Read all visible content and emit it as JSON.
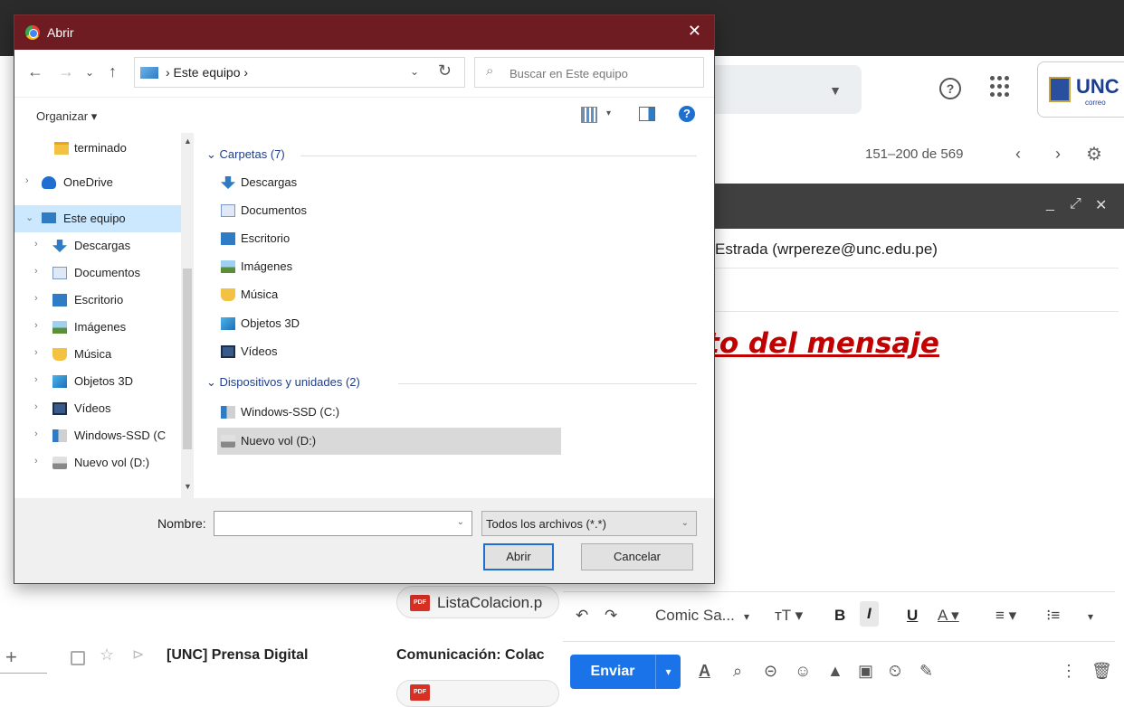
{
  "dialog": {
    "title": "Abrir",
    "close_glyph": "✕",
    "nav_back": "←",
    "nav_forward": "→",
    "nav_recent": "⌄",
    "nav_up": "↑",
    "breadcrumb": "› Este equipo ›",
    "breadcrumb_dropdown": "⌄",
    "refresh_glyph": "↻",
    "search_placeholder": "Buscar en Este equipo",
    "organize_label": "Organizar ▾",
    "view_dropdown": "▾",
    "help_glyph": "?",
    "nav_pane": [
      {
        "label": "terminado",
        "icon": "folder-icon",
        "arrow": ""
      },
      {
        "label": "OneDrive",
        "icon": "onedrive-icon",
        "arrow": "›"
      },
      {
        "label": "Este equipo",
        "icon": "computer-icon",
        "arrow": "⌄"
      },
      {
        "label": "Descargas",
        "icon": "downloads-icon",
        "arrow": "›"
      },
      {
        "label": "Documentos",
        "icon": "documents-icon",
        "arrow": "›"
      },
      {
        "label": "Escritorio",
        "icon": "desktop-icon",
        "arrow": "›"
      },
      {
        "label": "Imágenes",
        "icon": "pictures-icon",
        "arrow": "›"
      },
      {
        "label": "Música",
        "icon": "music-icon",
        "arrow": "›"
      },
      {
        "label": "Objetos 3D",
        "icon": "objects-3d-icon",
        "arrow": "›"
      },
      {
        "label": "Vídeos",
        "icon": "videos-icon",
        "arrow": "›"
      },
      {
        "label": "Windows-SSD (C",
        "icon": "drive-icon",
        "arrow": "›"
      },
      {
        "label": "Nuevo vol (D:)",
        "icon": "drive-icon",
        "arrow": "›"
      }
    ],
    "selected_nav": "Este equipo",
    "groups": {
      "folders_header": "Carpetas (7)",
      "folders": [
        {
          "label": "Descargas",
          "icon": "downloads-icon"
        },
        {
          "label": "Documentos",
          "icon": "documents-icon"
        },
        {
          "label": "Escritorio",
          "icon": "desktop-icon"
        },
        {
          "label": "Imágenes",
          "icon": "pictures-icon"
        },
        {
          "label": "Música",
          "icon": "music-icon"
        },
        {
          "label": "Objetos 3D",
          "icon": "objects-3d-icon"
        },
        {
          "label": "Vídeos",
          "icon": "videos-icon"
        }
      ],
      "devices_header": "Dispositivos y unidades (2)",
      "devices": [
        {
          "label": "Windows-SSD (C:)",
          "icon": "windows-drive-icon"
        },
        {
          "label": "Nuevo vol (D:)",
          "icon": "drive-icon"
        }
      ],
      "selected_device": "Nuevo vol (D:)"
    },
    "file_name_label": "Nombre:",
    "file_name_value": "",
    "file_type_filter": "Todos los archivos (*.*)",
    "open_button": "Abrir",
    "cancel_button": "Cancelar"
  },
  "gmail": {
    "pager_text": "151–200 de 569",
    "pager_prev": "‹",
    "pager_next": "›",
    "help_glyph": "?",
    "logo_text": "UNC",
    "logo_sub": "correo",
    "compose_controls": [
      "_",
      "⤢",
      "✕"
    ],
    "recipient": "Estrada (wrpereze@unc.edu.pe)",
    "message_text": "xto del mensaje",
    "attachment_name": "ListaColacion.p",
    "attachment_badge": "PDF",
    "format_bar": {
      "undo": "↶",
      "redo": "↷",
      "font": "Comic Sa...",
      "font_dd": "▾",
      "size": "тT ▾",
      "bold": "B",
      "italic": "I",
      "underline": "U",
      "text_color": "A ▾",
      "align": "≡ ▾",
      "numbered": "⁝≡",
      "more": "▾"
    },
    "send_label": "Enviar",
    "send_more": "▾",
    "send_toolbar": [
      "A",
      "⌕",
      "⊝",
      "☺",
      "▲",
      "▣",
      "⏲",
      "✎",
      "⋮",
      "🗑"
    ],
    "email_row": {
      "sender": "[UNC] Prensa Digital",
      "subject": "Comunicación: Colac",
      "plus": "+",
      "star": "☆",
      "important": "⊳"
    }
  },
  "colors": {
    "dialog_title_bar": "#6e1c22",
    "selection": "#cce8ff",
    "send_button": "#1a73e8",
    "message_red": "#c20000"
  }
}
